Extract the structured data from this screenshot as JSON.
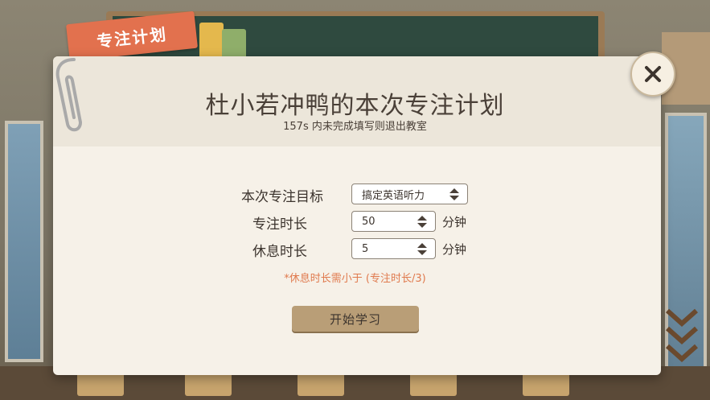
{
  "tab_label": "专注计划",
  "title": "杜小若冲鸭的本次专注计划",
  "subtitle": "157s 内未完成填写则退出教室",
  "form": {
    "goal": {
      "label": "本次专注目标",
      "value": "搞定英语听力"
    },
    "focus_duration": {
      "label": "专注时长",
      "value": "50",
      "unit": "分钟"
    },
    "rest_duration": {
      "label": "休息时长",
      "value": "5",
      "unit": "分钟"
    }
  },
  "note": "*休息时长需小于 (专注时长/3)",
  "start_button_label": "开始学习",
  "icons": {
    "close": "close-icon",
    "arrows": "up-down-arrows-icon",
    "paperclip": "paperclip-icon"
  },
  "colors": {
    "accent_tab": "#e2714e",
    "note": "#e07a4e",
    "button": "#b99e77"
  }
}
